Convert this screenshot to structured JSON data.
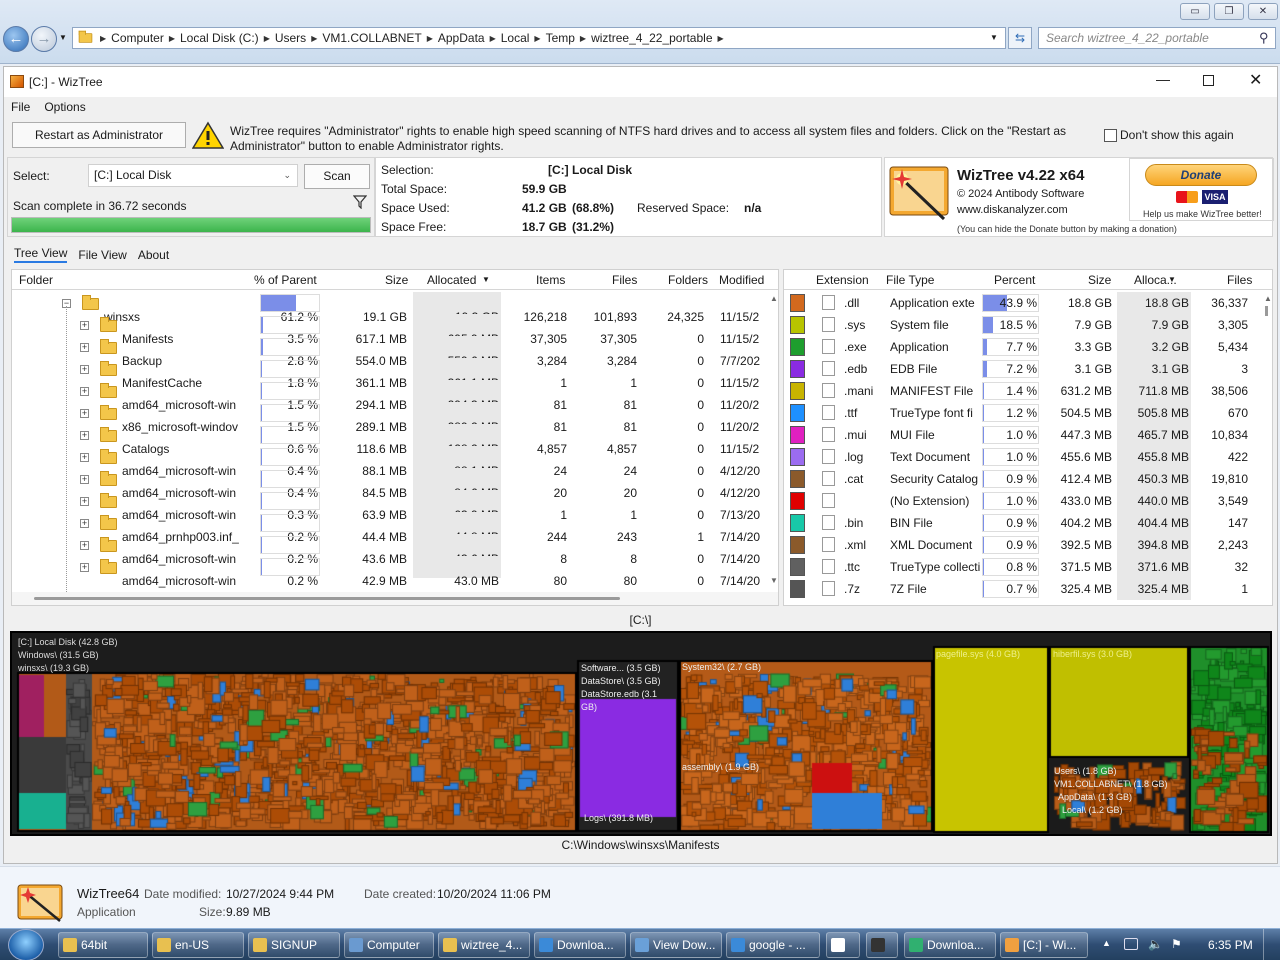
{
  "explorer": {
    "breadcrumbs": [
      "Computer",
      "Local Disk (C:)",
      "Users",
      "VM1.COLLABNET",
      "AppData",
      "Local",
      "Temp",
      "wiztree_4_22_portable"
    ],
    "search_placeholder": "Search wiztree_4_22_portable"
  },
  "window": {
    "title": "[C:]  - WizTree"
  },
  "menu": [
    "File",
    "Options"
  ],
  "admin": {
    "button": "Restart as Administrator",
    "message_line1": "WizTree requires \"Administrator\" rights to enable high speed scanning of NTFS hard drives and to access all system files and folders. Click on the \"Restart as",
    "message_line2": "Administrator\" button to enable Administrator rights.",
    "dont_show": "Don't show this again"
  },
  "scan": {
    "select_label": "Select:",
    "select_value": "[C:] Local Disk",
    "scan_button": "Scan",
    "status": "Scan complete in 36.72 seconds",
    "progress": 1.0
  },
  "info": {
    "selection_label": "Selection:",
    "selection_value": "[C:]  Local Disk",
    "total_label": "Total Space:",
    "total_value": "59.9 GB",
    "used_label": "Space Used:",
    "used_value": "41.2 GB",
    "used_pct": "(68.8%)",
    "reserved_label": "Reserved Space:",
    "reserved_value": "n/a",
    "free_label": "Space Free:",
    "free_value": "18.7 GB",
    "free_pct": "(31.2%)"
  },
  "about": {
    "title": "WizTree v4.22 x64",
    "copyright": "© 2024 Antibody Software",
    "url": "www.diskanalyzer.com",
    "donate": "Donate",
    "donate_note": "Help us make WizTree better!",
    "hide_note": "(You can hide the Donate button by making a donation)"
  },
  "tabs": [
    "Tree View",
    "File View",
    "About"
  ],
  "tree": {
    "columns": [
      "Folder",
      "% of Parent",
      "Size",
      "Allocated",
      "Items",
      "Files",
      "Folders",
      "Modified"
    ],
    "rows": [
      {
        "name": "winsxs",
        "pct": "61.2 %",
        "pct_value": 61.2,
        "size": "19.1 GB",
        "alloc": "19.3 GB",
        "items": "126,218",
        "files": "101,893",
        "folders": "24,325",
        "mod": "11/15/2",
        "level": 0
      },
      {
        "name": "Manifests",
        "pct": "3.5 %",
        "pct_value": 3.5,
        "size": "617.1 MB",
        "alloc": "695.9 MB",
        "items": "37,305",
        "files": "37,305",
        "folders": "0",
        "mod": "11/15/2",
        "level": 1
      },
      {
        "name": "Backup",
        "pct": "2.8 %",
        "pct_value": 2.8,
        "size": "554.0 MB",
        "alloc": "559.6 MB",
        "items": "3,284",
        "files": "3,284",
        "folders": "0",
        "mod": "7/7/202",
        "level": 1
      },
      {
        "name": "ManifestCache",
        "pct": "1.8 %",
        "pct_value": 1.8,
        "size": "361.1 MB",
        "alloc": "361.1 MB",
        "items": "1",
        "files": "1",
        "folders": "0",
        "mod": "11/15/2",
        "level": 1
      },
      {
        "name": "amd64_microsoft-win",
        "pct": "1.5 %",
        "pct_value": 1.5,
        "size": "294.1 MB",
        "alloc": "294.3 MB",
        "items": "81",
        "files": "81",
        "folders": "0",
        "mod": "11/20/2",
        "level": 1
      },
      {
        "name": "x86_microsoft-windov",
        "pct": "1.5 %",
        "pct_value": 1.5,
        "size": "289.1 MB",
        "alloc": "289.2 MB",
        "items": "81",
        "files": "81",
        "folders": "0",
        "mod": "11/20/2",
        "level": 1
      },
      {
        "name": "Catalogs",
        "pct": "0.6 %",
        "pct_value": 0.6,
        "size": "118.6 MB",
        "alloc": "128.2 MB",
        "items": "4,857",
        "files": "4,857",
        "folders": "0",
        "mod": "11/15/2",
        "level": 1
      },
      {
        "name": "amd64_microsoft-win",
        "pct": "0.4 %",
        "pct_value": 0.4,
        "size": "88.1 MB",
        "alloc": "88.1 MB",
        "items": "24",
        "files": "24",
        "folders": "0",
        "mod": "4/12/20",
        "level": 1
      },
      {
        "name": "amd64_microsoft-win",
        "pct": "0.4 %",
        "pct_value": 0.4,
        "size": "84.5 MB",
        "alloc": "84.6 MB",
        "items": "20",
        "files": "20",
        "folders": "0",
        "mod": "4/12/20",
        "level": 1
      },
      {
        "name": "amd64_microsoft-win",
        "pct": "0.3 %",
        "pct_value": 0.3,
        "size": "63.9 MB",
        "alloc": "63.9 MB",
        "items": "1",
        "files": "1",
        "folders": "0",
        "mod": "7/13/20",
        "level": 1
      },
      {
        "name": "amd64_prnhp003.inf_",
        "pct": "0.2 %",
        "pct_value": 0.2,
        "size": "44.4 MB",
        "alloc": "44.8 MB",
        "items": "244",
        "files": "243",
        "folders": "1",
        "mod": "7/14/20",
        "level": 1
      },
      {
        "name": "amd64_microsoft-win",
        "pct": "0.2 %",
        "pct_value": 0.2,
        "size": "43.6 MB",
        "alloc": "43.6 MB",
        "items": "8",
        "files": "8",
        "folders": "0",
        "mod": "7/14/20",
        "level": 1
      },
      {
        "name": "amd64_microsoft-win",
        "pct": "0.2 %",
        "pct_value": 0.2,
        "size": "42.9 MB",
        "alloc": "43.0 MB",
        "items": "80",
        "files": "80",
        "folders": "0",
        "mod": "7/14/20",
        "level": 1
      }
    ]
  },
  "filetypes": {
    "columns": [
      "Extension",
      "File Type",
      "Percent",
      "Size",
      "Alloca...",
      "Files"
    ],
    "rows": [
      {
        "color": "#d2691e",
        "ext": ".dll",
        "type": "Application exte",
        "pct": "43.9 %",
        "pct_value": 43.9,
        "size": "18.8 GB",
        "alloc": "18.8 GB",
        "files": "36,337"
      },
      {
        "color": "#b8c400",
        "ext": ".sys",
        "type": "System file",
        "pct": "18.5 %",
        "pct_value": 18.5,
        "size": "7.9 GB",
        "alloc": "7.9 GB",
        "files": "3,305"
      },
      {
        "color": "#1e9e2e",
        "ext": ".exe",
        "type": "Application",
        "pct": "7.7 %",
        "pct_value": 7.7,
        "size": "3.3 GB",
        "alloc": "3.2 GB",
        "files": "5,434"
      },
      {
        "color": "#8a2be2",
        "ext": ".edb",
        "type": "EDB File",
        "pct": "7.2 %",
        "pct_value": 7.2,
        "size": "3.1 GB",
        "alloc": "3.1 GB",
        "files": "3"
      },
      {
        "color": "#c8b400",
        "ext": ".mani",
        "type": "MANIFEST File",
        "pct": "1.4 %",
        "pct_value": 1.4,
        "size": "631.2 MB",
        "alloc": "711.8 MB",
        "files": "38,506"
      },
      {
        "color": "#1e90ff",
        "ext": ".ttf",
        "type": "TrueType font fi",
        "pct": "1.2 %",
        "pct_value": 1.2,
        "size": "504.5 MB",
        "alloc": "505.8 MB",
        "files": "670"
      },
      {
        "color": "#e020c0",
        "ext": ".mui",
        "type": "MUI File",
        "pct": "1.0 %",
        "pct_value": 1.0,
        "size": "447.3 MB",
        "alloc": "465.7 MB",
        "files": "10,834"
      },
      {
        "color": "#9b6cf0",
        "ext": ".log",
        "type": "Text Document",
        "pct": "1.0 %",
        "pct_value": 1.0,
        "size": "455.6 MB",
        "alloc": "455.8 MB",
        "files": "422"
      },
      {
        "color": "#8b5a2b",
        "ext": ".cat",
        "type": "Security Catalog",
        "pct": "0.9 %",
        "pct_value": 0.9,
        "size": "412.4 MB",
        "alloc": "450.3 MB",
        "files": "19,810"
      },
      {
        "color": "#e00000",
        "ext": "",
        "type": "(No Extension)",
        "pct": "1.0 %",
        "pct_value": 1.0,
        "size": "433.0 MB",
        "alloc": "440.0 MB",
        "files": "3,549"
      },
      {
        "color": "#18c8a8",
        "ext": ".bin",
        "type": "BIN File",
        "pct": "0.9 %",
        "pct_value": 0.9,
        "size": "404.2 MB",
        "alloc": "404.4 MB",
        "files": "147"
      },
      {
        "color": "#8b5a2b",
        "ext": ".xml",
        "type": "XML Document",
        "pct": "0.9 %",
        "pct_value": 0.9,
        "size": "392.5 MB",
        "alloc": "394.8 MB",
        "files": "2,243"
      },
      {
        "color": "#606060",
        "ext": ".ttc",
        "type": "TrueType collecti",
        "pct": "0.8 %",
        "pct_value": 0.8,
        "size": "371.5 MB",
        "alloc": "371.6 MB",
        "files": "32"
      },
      {
        "color": "#555555",
        "ext": ".7z",
        "type": "7Z File",
        "pct": "0.7 %",
        "pct_value": 0.7,
        "size": "325.4 MB",
        "alloc": "325.4 MB",
        "files": "1"
      }
    ]
  },
  "treemap": {
    "path_top": "[C:\\]",
    "path_bottom": "C:\\Windows\\winsxs\\Manifests",
    "labels": {
      "root": "[C:] Local Disk (42.8 GB)",
      "windows": "Windows\\ (31.5 GB)",
      "winsxs": "winsxs\\ (19.3 GB)",
      "software": "Software... (3.5 GB)",
      "datastore": "DataStore\\ (3.5 GB)",
      "datastore_edb": "DataStore.edb (3.1 GB)",
      "logs": "Logs\\ (391.8 MB)",
      "system32": "System32\\ (2.7 GB)",
      "assembly": "assembly\\ (1.9 GB)",
      "pagefile": "pagefile.sys (4.0 GB)",
      "hiberfil": "hiberfil.sys (3.0 GB)",
      "users": "Users\\ (1.8 GB)",
      "vm1": "VM1.COLLABNET\\ (1.8 GB)",
      "appdata": "AppData\\ (1.3 GB)",
      "local": "Local\\ (1.2 GB)"
    }
  },
  "details": {
    "name": "WizTree64",
    "type": "Application",
    "modified_label": "Date modified:",
    "modified": "10/27/2024 9:44 PM",
    "created_label": "Date created:",
    "created": "10/20/2024 11:06 PM",
    "size_label": "Size:",
    "size": "9.89 MB"
  },
  "taskbar": {
    "items": [
      {
        "label": "64bit",
        "color": "#e8c050"
      },
      {
        "label": "en-US",
        "color": "#e8c050"
      },
      {
        "label": "SIGNUP",
        "color": "#e8c050"
      },
      {
        "label": "Computer",
        "color": "#6a9ad0"
      },
      {
        "label": "wiztree_4...",
        "color": "#e8c050"
      },
      {
        "label": "Downloa...",
        "color": "#3b8ad8"
      },
      {
        "label": "View Dow...",
        "color": "#6aa0d8"
      },
      {
        "label": "google - ...",
        "color": "#3b8ad8"
      },
      {
        "label": "",
        "color": "#ffffff"
      },
      {
        "label": "",
        "color": "#333333"
      },
      {
        "label": "Downloa...",
        "color": "#30b070"
      },
      {
        "label": "[C:] - Wi...",
        "color": "#f0a040"
      }
    ],
    "clock": "6:35 PM"
  }
}
